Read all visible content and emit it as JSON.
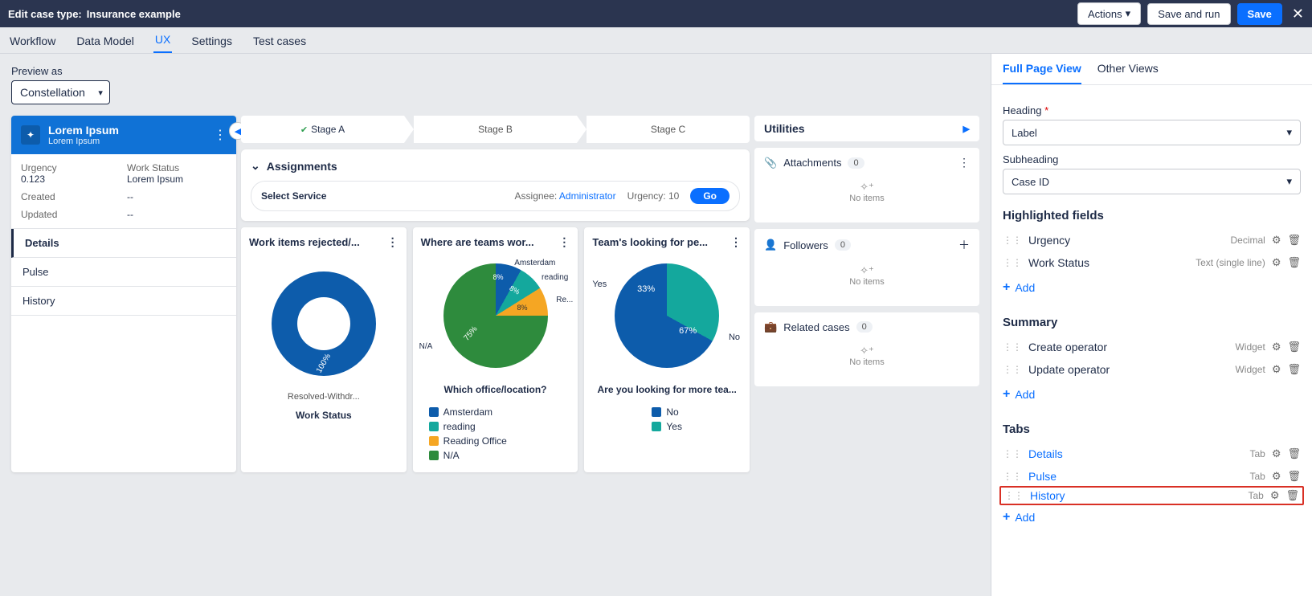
{
  "topbar": {
    "prefix": "Edit case type:",
    "name": "Insurance example",
    "actions_label": "Actions",
    "save_run_label": "Save and run",
    "save_label": "Save"
  },
  "nav_tabs": [
    "Workflow",
    "Data Model",
    "UX",
    "Settings",
    "Test cases"
  ],
  "nav_active": 2,
  "preview": {
    "label": "Preview as",
    "value": "Constellation"
  },
  "case": {
    "title": "Lorem Ipsum",
    "subtitle": "Lorem Ipsum",
    "info": {
      "urgency_label": "Urgency",
      "urgency_value": "0.123",
      "workstatus_label": "Work Status",
      "workstatus_value": "Lorem Ipsum",
      "created_label": "Created",
      "created_value": "--",
      "updated_label": "Updated",
      "updated_value": "--"
    },
    "side_tabs": [
      "Details",
      "Pulse",
      "History"
    ],
    "side_active": 0
  },
  "stages": [
    "Stage A",
    "Stage B",
    "Stage C"
  ],
  "assignments": {
    "heading": "Assignments",
    "row_label": "Select Service",
    "assignee_label": "Assignee:",
    "assignee_value": "Administrator",
    "urgency_label": "Urgency:",
    "urgency_value": "10",
    "go_label": "Go"
  },
  "widgets": [
    {
      "title": "Work items rejected/..."
    },
    {
      "title": "Where are teams wor..."
    },
    {
      "title": "Team's looking for pe..."
    }
  ],
  "chart_data": [
    {
      "type": "pie",
      "donut": true,
      "title": "Work Status",
      "categories": [
        "Resolved-Withdr..."
      ],
      "values": [
        100
      ],
      "colors": [
        "#0d5cab"
      ],
      "value_labels": [
        "100%"
      ]
    },
    {
      "type": "pie",
      "title": "Which office/location?",
      "categories": [
        "Amsterdam",
        "reading",
        "Reading Office",
        "N/A"
      ],
      "values": [
        8,
        8,
        8,
        75
      ],
      "colors": [
        "#0d5cab",
        "#14a89d",
        "#f5a623",
        "#2e8b3d"
      ],
      "value_labels": [
        "8%",
        "8%",
        "8%",
        "75%"
      ],
      "outer_label_na": "N/A",
      "outer_label_re": "Re..."
    },
    {
      "type": "pie",
      "title": "Are you looking for more tea...",
      "categories": [
        "No",
        "Yes"
      ],
      "values": [
        67,
        33
      ],
      "colors": [
        "#0d5cab",
        "#14a89d"
      ],
      "value_labels": [
        "67%",
        "33%"
      ],
      "outer_label_no": "No",
      "outer_label_yes": "Yes"
    }
  ],
  "utilities": {
    "heading": "Utilities",
    "no_items": "No items",
    "cards": [
      {
        "icon": "paperclip",
        "label": "Attachments",
        "count": "0",
        "action": "menu"
      },
      {
        "icon": "person",
        "label": "Followers",
        "count": "0",
        "action": "plus"
      },
      {
        "icon": "briefcase",
        "label": "Related cases",
        "count": "0",
        "action": ""
      }
    ]
  },
  "config": {
    "tabs": [
      "Full Page View",
      "Other Views"
    ],
    "tab_active": 0,
    "heading_label": "Heading",
    "heading_value": "Label",
    "subheading_label": "Subheading",
    "subheading_value": "Case ID",
    "sections": {
      "highlighted": {
        "title": "Highlighted fields",
        "rows": [
          {
            "label": "Urgency",
            "type": "Decimal"
          },
          {
            "label": "Work Status",
            "type": "Text (single line)"
          }
        ]
      },
      "summary": {
        "title": "Summary",
        "rows": [
          {
            "label": "Create operator",
            "type": "Widget"
          },
          {
            "label": "Update operator",
            "type": "Widget"
          }
        ]
      },
      "tabs_sec": {
        "title": "Tabs",
        "rows": [
          {
            "label": "Details",
            "type": "Tab"
          },
          {
            "label": "Pulse",
            "type": "Tab"
          },
          {
            "label": "History",
            "type": "Tab",
            "highlighted": true
          }
        ]
      }
    },
    "add_label": "Add"
  }
}
